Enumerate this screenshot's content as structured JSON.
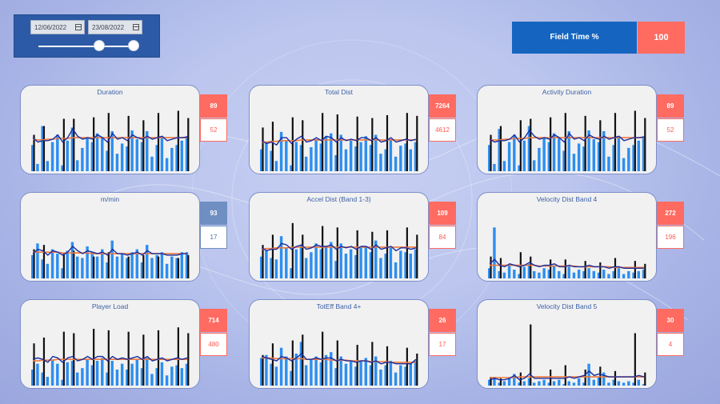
{
  "filters": {
    "start_date": "12/06/2022",
    "end_date": "23/08/2022"
  },
  "kpi": {
    "label": "Field Time %",
    "value": "100"
  },
  "colors": {
    "bar": "#2d8ef0",
    "marker": "#111111",
    "line_avg": "#1a2da0",
    "line_ref": "#ee7a3c",
    "badge_red": "#ff6b61",
    "badge_blue": "#6f8fc2"
  },
  "cards": [
    {
      "title": "Duration",
      "top": "89",
      "bottom": "52",
      "style": "red",
      "bars": [
        0.36,
        0.1,
        0.62,
        0.14,
        0.4,
        0.5,
        0.08,
        0.42,
        0.6,
        0.15,
        0.32,
        0.46,
        0.4,
        0.52,
        0.45,
        0.28,
        0.55,
        0.24,
        0.38,
        0.34,
        0.56,
        0.44,
        0.4,
        0.55,
        0.2,
        0.36,
        0.47,
        0.18,
        0.32,
        0.36,
        0.42,
        0.48
      ],
      "marks": [
        0.5,
        0.0,
        0.62,
        0.0,
        0.0,
        0.0,
        0.72,
        0.0,
        0.72,
        0.0,
        0.0,
        0.0,
        0.74,
        0.0,
        0.0,
        0.8,
        0.0,
        0.0,
        0.0,
        0.76,
        0.0,
        0.0,
        0.7,
        0.0,
        0.0,
        0.8,
        0.0,
        0.0,
        0.0,
        0.83,
        0.0,
        0.73
      ],
      "avg": [
        0.46,
        0.4,
        0.42,
        0.42,
        0.44,
        0.5,
        0.4,
        0.46,
        0.58,
        0.48,
        0.44,
        0.46,
        0.44,
        0.5,
        0.46,
        0.4,
        0.52,
        0.44,
        0.46,
        0.42,
        0.5,
        0.46,
        0.44,
        0.48,
        0.44,
        0.46,
        0.48,
        0.42,
        0.44,
        0.46,
        0.46,
        0.47
      ],
      "ref": [
        0.44,
        0.43,
        0.43,
        0.44,
        0.44,
        0.45,
        0.45,
        0.45,
        0.46,
        0.46,
        0.46,
        0.46,
        0.46,
        0.46,
        0.46,
        0.46,
        0.46,
        0.46,
        0.46,
        0.46,
        0.46,
        0.46,
        0.46,
        0.46,
        0.46,
        0.46,
        0.46,
        0.46,
        0.46,
        0.46,
        0.46,
        0.46
      ]
    },
    {
      "title": "Total Dist",
      "top": "7264",
      "bottom": "4612",
      "style": "red",
      "bars": [
        0.3,
        0.4,
        0.28,
        0.14,
        0.54,
        0.42,
        0.08,
        0.4,
        0.36,
        0.2,
        0.33,
        0.44,
        0.38,
        0.48,
        0.52,
        0.22,
        0.5,
        0.3,
        0.42,
        0.34,
        0.4,
        0.48,
        0.36,
        0.5,
        0.24,
        0.3,
        0.44,
        0.2,
        0.35,
        0.38,
        0.3,
        0.4
      ],
      "marks": [
        0.6,
        0.0,
        0.68,
        0.0,
        0.0,
        0.0,
        0.74,
        0.0,
        0.7,
        0.0,
        0.0,
        0.0,
        0.8,
        0.0,
        0.0,
        0.78,
        0.0,
        0.0,
        0.0,
        0.75,
        0.0,
        0.0,
        0.73,
        0.0,
        0.0,
        0.77,
        0.0,
        0.0,
        0.0,
        0.8,
        0.0,
        0.76
      ],
      "avg": [
        0.42,
        0.38,
        0.4,
        0.36,
        0.46,
        0.46,
        0.38,
        0.44,
        0.48,
        0.4,
        0.42,
        0.46,
        0.42,
        0.48,
        0.46,
        0.4,
        0.46,
        0.42,
        0.44,
        0.42,
        0.46,
        0.46,
        0.42,
        0.46,
        0.4,
        0.42,
        0.46,
        0.4,
        0.42,
        0.44,
        0.42,
        0.44
      ],
      "ref": [
        0.4,
        0.4,
        0.41,
        0.41,
        0.42,
        0.42,
        0.42,
        0.42,
        0.43,
        0.43,
        0.43,
        0.43,
        0.43,
        0.43,
        0.43,
        0.43,
        0.43,
        0.43,
        0.43,
        0.43,
        0.43,
        0.43,
        0.43,
        0.43,
        0.43,
        0.43,
        0.43,
        0.43,
        0.43,
        0.43,
        0.43,
        0.43
      ]
    },
    {
      "title": "Activity Duration",
      "top": "89",
      "bottom": "52",
      "style": "red",
      "bars": [
        0.36,
        0.1,
        0.58,
        0.14,
        0.4,
        0.5,
        0.08,
        0.42,
        0.62,
        0.15,
        0.32,
        0.46,
        0.4,
        0.52,
        0.45,
        0.28,
        0.55,
        0.24,
        0.38,
        0.34,
        0.56,
        0.44,
        0.4,
        0.55,
        0.2,
        0.36,
        0.47,
        0.18,
        0.32,
        0.36,
        0.42,
        0.48
      ],
      "marks": [
        0.5,
        0.0,
        0.62,
        0.0,
        0.0,
        0.0,
        0.7,
        0.0,
        0.72,
        0.0,
        0.0,
        0.0,
        0.74,
        0.0,
        0.0,
        0.8,
        0.0,
        0.0,
        0.0,
        0.76,
        0.0,
        0.0,
        0.7,
        0.0,
        0.0,
        0.8,
        0.0,
        0.0,
        0.0,
        0.83,
        0.0,
        0.73
      ],
      "avg": [
        0.44,
        0.4,
        0.42,
        0.42,
        0.44,
        0.5,
        0.4,
        0.46,
        0.56,
        0.48,
        0.44,
        0.46,
        0.44,
        0.5,
        0.46,
        0.4,
        0.52,
        0.44,
        0.46,
        0.42,
        0.5,
        0.46,
        0.44,
        0.48,
        0.44,
        0.46,
        0.48,
        0.42,
        0.44,
        0.46,
        0.46,
        0.47
      ],
      "ref": [
        0.43,
        0.43,
        0.43,
        0.44,
        0.44,
        0.45,
        0.45,
        0.45,
        0.46,
        0.46,
        0.46,
        0.46,
        0.46,
        0.46,
        0.46,
        0.46,
        0.46,
        0.46,
        0.46,
        0.46,
        0.46,
        0.46,
        0.46,
        0.46,
        0.46,
        0.46,
        0.46,
        0.46,
        0.46,
        0.46,
        0.46,
        0.46
      ]
    },
    {
      "title": "m/min",
      "top": "93",
      "bottom": "17",
      "style": "blue",
      "bars": [
        0.32,
        0.48,
        0.26,
        0.2,
        0.4,
        0.34,
        0.14,
        0.38,
        0.5,
        0.3,
        0.28,
        0.44,
        0.36,
        0.3,
        0.4,
        0.22,
        0.52,
        0.3,
        0.34,
        0.28,
        0.36,
        0.4,
        0.22,
        0.46,
        0.28,
        0.32,
        0.36,
        0.2,
        0.3,
        0.28,
        0.36,
        0.36
      ],
      "marks": [
        0.4,
        0.0,
        0.46,
        0.0,
        0.0,
        0.0,
        0.34,
        0.0,
        0.38,
        0.0,
        0.0,
        0.0,
        0.3,
        0.0,
        0.0,
        0.36,
        0.0,
        0.0,
        0.0,
        0.3,
        0.0,
        0.0,
        0.32,
        0.0,
        0.0,
        0.3,
        0.0,
        0.0,
        0.0,
        0.28,
        0.0,
        0.32
      ],
      "avg": [
        0.34,
        0.4,
        0.38,
        0.32,
        0.38,
        0.36,
        0.32,
        0.36,
        0.44,
        0.38,
        0.34,
        0.38,
        0.36,
        0.34,
        0.36,
        0.32,
        0.4,
        0.34,
        0.34,
        0.32,
        0.34,
        0.36,
        0.32,
        0.38,
        0.34,
        0.34,
        0.34,
        0.32,
        0.32,
        0.32,
        0.34,
        0.34
      ],
      "ref": [
        0.36,
        0.36,
        0.36,
        0.36,
        0.36,
        0.36,
        0.35,
        0.35,
        0.35,
        0.35,
        0.35,
        0.35,
        0.34,
        0.34,
        0.34,
        0.34,
        0.34,
        0.34,
        0.34,
        0.34,
        0.34,
        0.34,
        0.34,
        0.34,
        0.34,
        0.34,
        0.34,
        0.34,
        0.34,
        0.34,
        0.34,
        0.34
      ]
    },
    {
      "title": "Accel Dist (Band 1-3)",
      "top": "109",
      "bottom": "84",
      "style": "red",
      "bars": [
        0.3,
        0.38,
        0.28,
        0.26,
        0.58,
        0.42,
        0.14,
        0.4,
        0.46,
        0.28,
        0.36,
        0.48,
        0.4,
        0.44,
        0.5,
        0.24,
        0.48,
        0.34,
        0.4,
        0.32,
        0.42,
        0.44,
        0.36,
        0.52,
        0.28,
        0.34,
        0.42,
        0.22,
        0.38,
        0.36,
        0.34,
        0.4
      ],
      "marks": [
        0.46,
        0.0,
        0.6,
        0.0,
        0.0,
        0.0,
        0.76,
        0.0,
        0.6,
        0.0,
        0.0,
        0.0,
        0.72,
        0.0,
        0.0,
        0.7,
        0.0,
        0.0,
        0.0,
        0.66,
        0.0,
        0.0,
        0.64,
        0.0,
        0.0,
        0.66,
        0.0,
        0.0,
        0.0,
        0.7,
        0.0,
        0.6
      ],
      "avg": [
        0.42,
        0.38,
        0.4,
        0.4,
        0.48,
        0.46,
        0.4,
        0.44,
        0.46,
        0.4,
        0.42,
        0.46,
        0.44,
        0.44,
        0.46,
        0.4,
        0.44,
        0.42,
        0.44,
        0.4,
        0.44,
        0.44,
        0.4,
        0.46,
        0.4,
        0.42,
        0.44,
        0.38,
        0.42,
        0.42,
        0.4,
        0.42
      ],
      "ref": [
        0.4,
        0.41,
        0.41,
        0.42,
        0.42,
        0.42,
        0.43,
        0.43,
        0.43,
        0.43,
        0.43,
        0.43,
        0.43,
        0.43,
        0.43,
        0.43,
        0.43,
        0.43,
        0.43,
        0.43,
        0.43,
        0.43,
        0.43,
        0.43,
        0.43,
        0.43,
        0.43,
        0.43,
        0.43,
        0.43,
        0.43,
        0.43
      ]
    },
    {
      "title": "Velocity Dist Band 4",
      "top": "272",
      "bottom": "196",
      "style": "red",
      "bars": [
        0.14,
        0.7,
        0.1,
        0.08,
        0.18,
        0.12,
        0.06,
        0.16,
        0.2,
        0.1,
        0.08,
        0.14,
        0.12,
        0.18,
        0.1,
        0.06,
        0.16,
        0.08,
        0.12,
        0.1,
        0.14,
        0.1,
        0.08,
        0.12,
        0.06,
        0.1,
        0.14,
        0.06,
        0.1,
        0.08,
        0.1,
        0.12
      ],
      "marks": [
        0.3,
        0.0,
        0.28,
        0.0,
        0.0,
        0.0,
        0.36,
        0.0,
        0.3,
        0.0,
        0.0,
        0.0,
        0.26,
        0.0,
        0.0,
        0.26,
        0.0,
        0.0,
        0.0,
        0.24,
        0.0,
        0.0,
        0.22,
        0.0,
        0.0,
        0.28,
        0.0,
        0.0,
        0.0,
        0.24,
        0.0,
        0.2
      ],
      "avg": [
        0.2,
        0.26,
        0.18,
        0.16,
        0.2,
        0.18,
        0.16,
        0.18,
        0.22,
        0.18,
        0.16,
        0.18,
        0.18,
        0.2,
        0.16,
        0.16,
        0.18,
        0.16,
        0.16,
        0.16,
        0.18,
        0.16,
        0.16,
        0.16,
        0.14,
        0.16,
        0.16,
        0.14,
        0.14,
        0.14,
        0.14,
        0.14
      ],
      "ref": [
        0.18,
        0.18,
        0.18,
        0.18,
        0.18,
        0.18,
        0.18,
        0.18,
        0.18,
        0.18,
        0.17,
        0.17,
        0.17,
        0.17,
        0.17,
        0.17,
        0.17,
        0.17,
        0.16,
        0.16,
        0.16,
        0.16,
        0.16,
        0.16,
        0.16,
        0.15,
        0.15,
        0.15,
        0.15,
        0.15,
        0.15,
        0.15
      ]
    },
    {
      "title": "Player Load",
      "top": "714",
      "bottom": "480",
      "style": "red",
      "bars": [
        0.22,
        0.3,
        0.18,
        0.12,
        0.36,
        0.3,
        0.08,
        0.32,
        0.34,
        0.18,
        0.24,
        0.36,
        0.28,
        0.34,
        0.38,
        0.18,
        0.34,
        0.22,
        0.3,
        0.22,
        0.3,
        0.36,
        0.24,
        0.38,
        0.16,
        0.24,
        0.32,
        0.14,
        0.26,
        0.28,
        0.24,
        0.3
      ],
      "marks": [
        0.58,
        0.0,
        0.66,
        0.0,
        0.0,
        0.0,
        0.74,
        0.0,
        0.72,
        0.0,
        0.0,
        0.0,
        0.78,
        0.0,
        0.0,
        0.76,
        0.0,
        0.0,
        0.0,
        0.74,
        0.0,
        0.0,
        0.7,
        0.0,
        0.0,
        0.76,
        0.0,
        0.0,
        0.0,
        0.8,
        0.0,
        0.72
      ],
      "avg": [
        0.36,
        0.38,
        0.36,
        0.32,
        0.4,
        0.38,
        0.32,
        0.38,
        0.4,
        0.34,
        0.36,
        0.4,
        0.36,
        0.4,
        0.4,
        0.34,
        0.4,
        0.36,
        0.38,
        0.36,
        0.38,
        0.4,
        0.36,
        0.4,
        0.34,
        0.36,
        0.38,
        0.34,
        0.36,
        0.38,
        0.36,
        0.38
      ],
      "ref": [
        0.34,
        0.34,
        0.35,
        0.35,
        0.35,
        0.36,
        0.36,
        0.36,
        0.36,
        0.36,
        0.36,
        0.36,
        0.36,
        0.36,
        0.36,
        0.36,
        0.36,
        0.36,
        0.36,
        0.36,
        0.36,
        0.36,
        0.36,
        0.36,
        0.36,
        0.36,
        0.36,
        0.36,
        0.36,
        0.36,
        0.36,
        0.36
      ]
    },
    {
      "title": "TotEff Band 4+",
      "top": "26",
      "bottom": "17",
      "style": "red",
      "bars": [
        0.38,
        0.42,
        0.3,
        0.26,
        0.52,
        0.4,
        0.2,
        0.44,
        0.6,
        0.28,
        0.36,
        0.4,
        0.32,
        0.42,
        0.46,
        0.24,
        0.4,
        0.3,
        0.34,
        0.26,
        0.34,
        0.38,
        0.28,
        0.4,
        0.22,
        0.28,
        0.34,
        0.18,
        0.28,
        0.26,
        0.3,
        0.34
      ],
      "marks": [
        0.42,
        0.0,
        0.58,
        0.0,
        0.0,
        0.0,
        0.62,
        0.0,
        0.7,
        0.0,
        0.0,
        0.0,
        0.74,
        0.0,
        0.0,
        0.62,
        0.0,
        0.0,
        0.0,
        0.56,
        0.0,
        0.0,
        0.6,
        0.0,
        0.0,
        0.54,
        0.0,
        0.0,
        0.0,
        0.52,
        0.0,
        0.44
      ],
      "avg": [
        0.4,
        0.38,
        0.36,
        0.34,
        0.4,
        0.38,
        0.34,
        0.38,
        0.44,
        0.36,
        0.36,
        0.38,
        0.36,
        0.38,
        0.38,
        0.34,
        0.36,
        0.34,
        0.34,
        0.32,
        0.34,
        0.34,
        0.32,
        0.34,
        0.3,
        0.32,
        0.32,
        0.3,
        0.3,
        0.3,
        0.3,
        0.36
      ],
      "ref": [
        0.38,
        0.38,
        0.38,
        0.37,
        0.37,
        0.37,
        0.37,
        0.37,
        0.37,
        0.36,
        0.36,
        0.36,
        0.36,
        0.36,
        0.35,
        0.35,
        0.35,
        0.35,
        0.34,
        0.34,
        0.34,
        0.34,
        0.33,
        0.33,
        0.33,
        0.33,
        0.32,
        0.32,
        0.32,
        0.32,
        0.32,
        0.32
      ]
    },
    {
      "title": "Velocity Dist Band 5",
      "top": "30",
      "bottom": "4",
      "style": "red",
      "bars": [
        0.08,
        0.12,
        0.04,
        0.06,
        0.1,
        0.16,
        0.04,
        0.06,
        0.1,
        0.04,
        0.06,
        0.08,
        0.04,
        0.06,
        0.08,
        0.02,
        0.06,
        0.04,
        0.1,
        0.04,
        0.3,
        0.08,
        0.12,
        0.18,
        0.04,
        0.08,
        0.06,
        0.04,
        0.06,
        0.04,
        0.08,
        0.02
      ],
      "marks": [
        0.12,
        0.0,
        0.1,
        0.0,
        0.0,
        0.0,
        0.18,
        0.0,
        0.84,
        0.0,
        0.0,
        0.0,
        0.22,
        0.0,
        0.0,
        0.28,
        0.0,
        0.0,
        0.0,
        0.22,
        0.0,
        0.0,
        0.26,
        0.0,
        0.0,
        0.2,
        0.0,
        0.0,
        0.0,
        0.72,
        0.0,
        0.18
      ],
      "avg": [
        0.08,
        0.1,
        0.08,
        0.08,
        0.1,
        0.14,
        0.08,
        0.1,
        0.16,
        0.1,
        0.1,
        0.1,
        0.1,
        0.1,
        0.1,
        0.1,
        0.12,
        0.1,
        0.12,
        0.14,
        0.2,
        0.14,
        0.16,
        0.14,
        0.12,
        0.12,
        0.12,
        0.12,
        0.12,
        0.12,
        0.14,
        0.12
      ],
      "ref": [
        0.11,
        0.11,
        0.11,
        0.11,
        0.11,
        0.11,
        0.12,
        0.12,
        0.12,
        0.12,
        0.12,
        0.12,
        0.12,
        0.12,
        0.12,
        0.12,
        0.12,
        0.12,
        0.12,
        0.12,
        0.12,
        0.12,
        0.12,
        0.12,
        0.12,
        0.12,
        0.12,
        0.12,
        0.12,
        0.12,
        0.12,
        0.12
      ]
    }
  ]
}
